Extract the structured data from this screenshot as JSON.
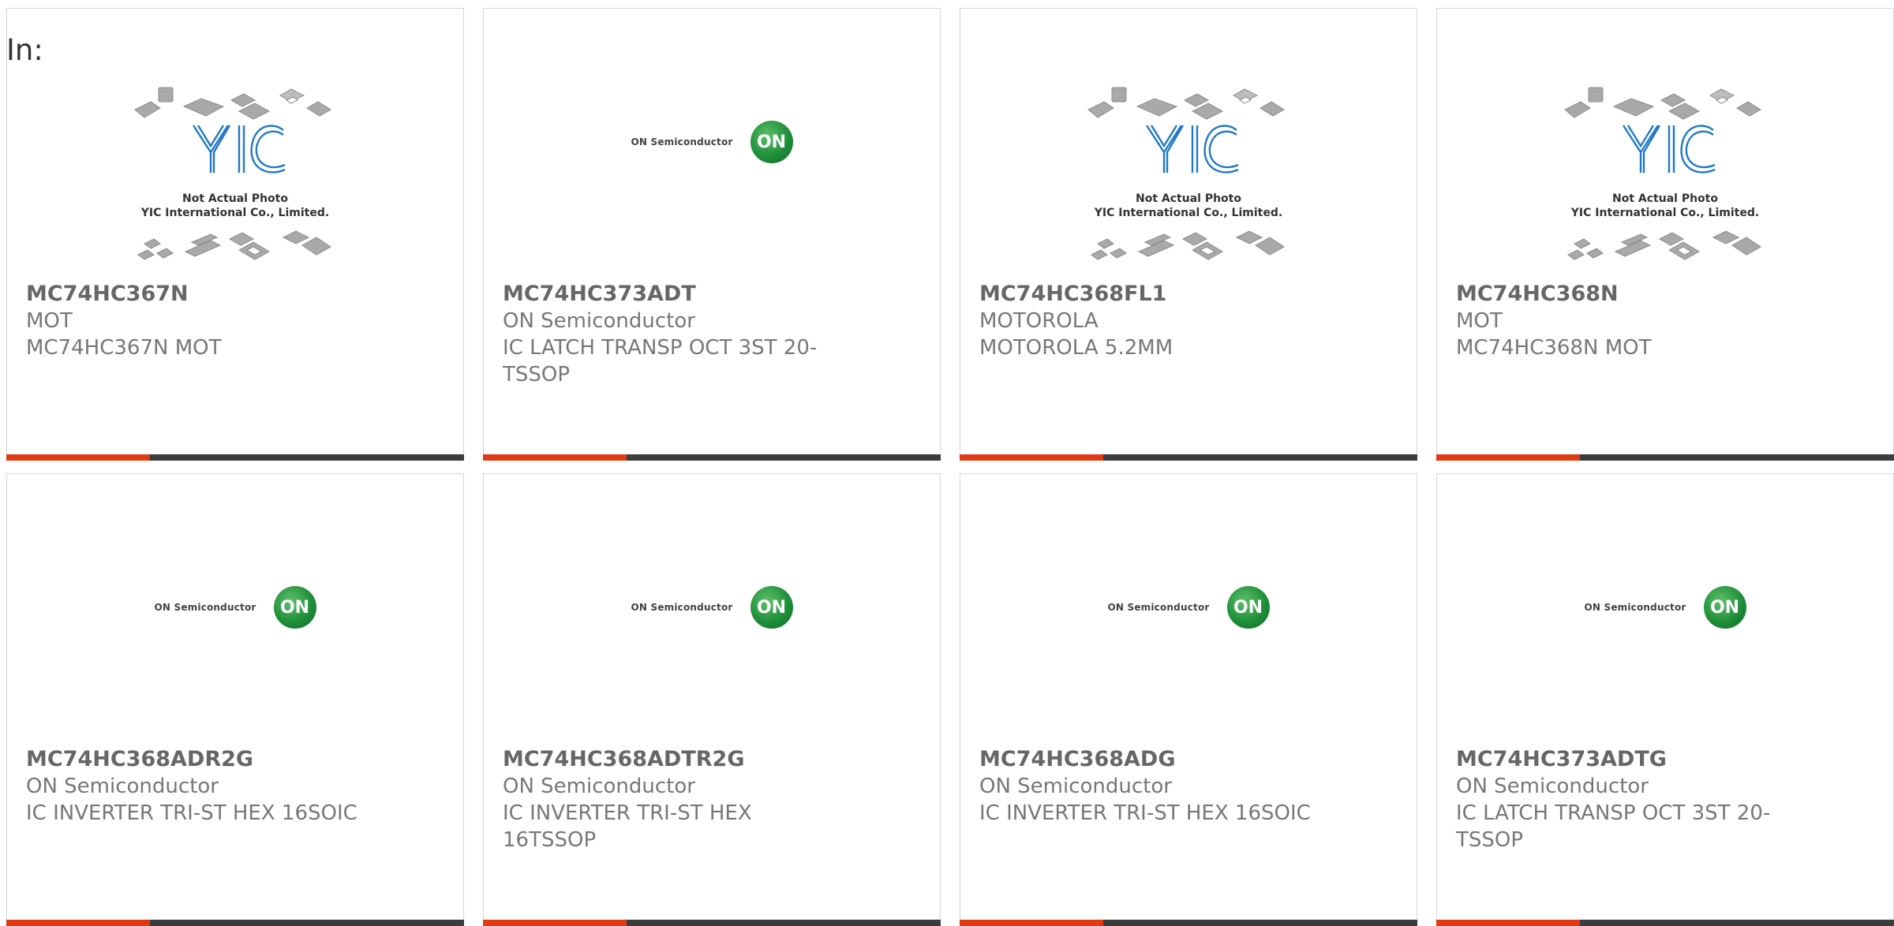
{
  "header": {
    "in_label": "In:"
  },
  "colors": {
    "accent": "#e03a15",
    "bar": "#3c3c3c",
    "text": "#666666"
  },
  "placeholder_caption": {
    "line1": "Not Actual Photo",
    "line2": "YIC International Co., Limited."
  },
  "logo_text": {
    "on_semi": "ON Semiconductor",
    "on_circle": "ON"
  },
  "products": [
    {
      "part": "MC74HC367N",
      "mfr": "MOT",
      "desc": "MC74HC367N MOT",
      "image": "yic-placeholder"
    },
    {
      "part": "MC74HC373ADT",
      "mfr": "ON Semiconductor",
      "desc": "IC LATCH TRANSP OCT 3ST 20-TSSOP",
      "image": "on-semi-logo"
    },
    {
      "part": "MC74HC368FL1",
      "mfr": "MOTOROLA",
      "desc": "MOTOROLA 5.2MM",
      "image": "yic-placeholder"
    },
    {
      "part": "MC74HC368N",
      "mfr": "MOT",
      "desc": "MC74HC368N MOT",
      "image": "yic-placeholder"
    },
    {
      "part": "MC74HC368ADR2G",
      "mfr": "ON Semiconductor",
      "desc": "IC INVERTER TRI-ST HEX 16SOIC",
      "image": "on-semi-logo"
    },
    {
      "part": "MC74HC368ADTR2G",
      "mfr": "ON Semiconductor",
      "desc": "IC INVERTER TRI-ST HEX 16TSSOP",
      "image": "on-semi-logo"
    },
    {
      "part": "MC74HC368ADG",
      "mfr": "ON Semiconductor",
      "desc": "IC INVERTER TRI-ST HEX 16SOIC",
      "image": "on-semi-logo"
    },
    {
      "part": "MC74HC373ADTG",
      "mfr": "ON Semiconductor",
      "desc": "IC LATCH TRANSP OCT 3ST 20-TSSOP",
      "image": "on-semi-logo"
    }
  ]
}
